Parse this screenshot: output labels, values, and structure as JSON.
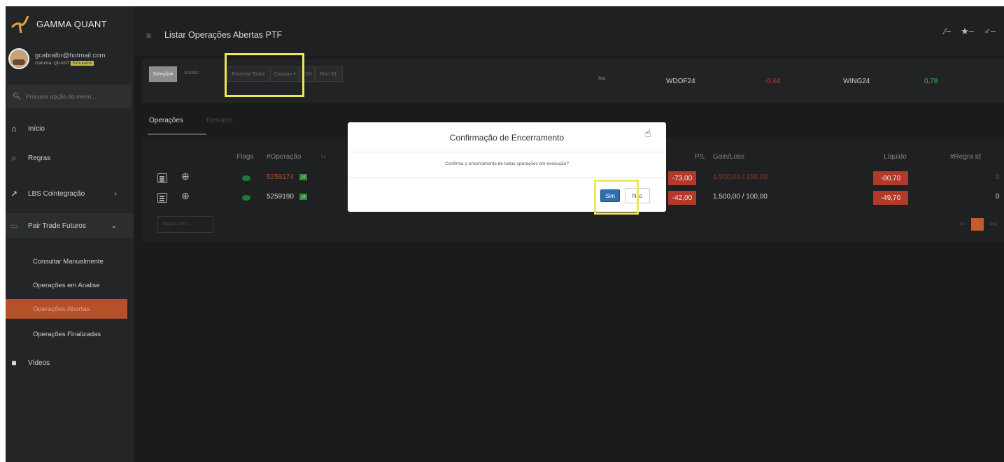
{
  "app": {
    "brand": "GAMMA QUANT"
  },
  "user": {
    "email": "gcabralbr@hotmail.com",
    "tag": "Gamma: QUANT",
    "badge": "Simulador"
  },
  "search": {
    "placeholder": "Procurar opção do menu..."
  },
  "sidebar": {
    "items": [
      {
        "label": "Início",
        "icon": "home-icon"
      },
      {
        "label": "Regras",
        "icon": "search-rules-icon"
      },
      {
        "label": "LBS Cointegração",
        "icon": "chart-icon"
      },
      {
        "label": "Pair Trade Futuros",
        "icon": "pair-icon"
      },
      {
        "label": "Vídeos",
        "icon": "video-icon"
      }
    ],
    "sub_items": [
      {
        "label": "Consultar Manualmente"
      },
      {
        "label": "Operações em Analise"
      },
      {
        "label": "Operações Abertas"
      },
      {
        "label": "Operações Finalizadas"
      }
    ]
  },
  "header": {
    "title": "Listar Operações Abertas PTF"
  },
  "toolbar": {
    "selecao": "Seleção",
    "atualizar": "Atualiz",
    "encerrar": "Encerrar Todas",
    "colunas": "Colunas",
    "csv": "CSV",
    "mon": "Mon GL",
    "atu": "Atu"
  },
  "quotes": [
    {
      "symbol": "WDOF24",
      "value": "-0,64",
      "color": "#cc3333"
    },
    {
      "symbol": "WING24",
      "value": "0,78",
      "color": "#38c04a"
    }
  ],
  "tabs": {
    "active": "Operações",
    "inactive": "Resumo"
  },
  "table": {
    "headers": {
      "flags": "Flags",
      "operacao": "#Operação",
      "sort": "↑↓",
      "pl": "P/L",
      "gainloss": "Gain/Loss",
      "liquido": "Líquido",
      "regra": "#Regra Id"
    },
    "rows": [
      {
        "operacao": "5259174",
        "badge": "pt",
        "pl": "-73,00",
        "gainloss": "1.500,00 / 150,00",
        "liquido": "-80,70",
        "regra": "0"
      },
      {
        "operacao": "5259190",
        "badge": "pt",
        "pl": "-42,00",
        "gainloss": "1.500,00 / 100,00",
        "liquido": "-49,70",
        "regra": "0"
      }
    ],
    "pager_info": "Página 1 de 1",
    "pager_prev": "Ant",
    "pager_current": "1",
    "pager_next": "Seg"
  },
  "modal": {
    "title": "Confirmação de Encerramento",
    "body": "Confirma o encerramento de todas operações em execução?",
    "yes": "Sim",
    "no": "Não"
  }
}
